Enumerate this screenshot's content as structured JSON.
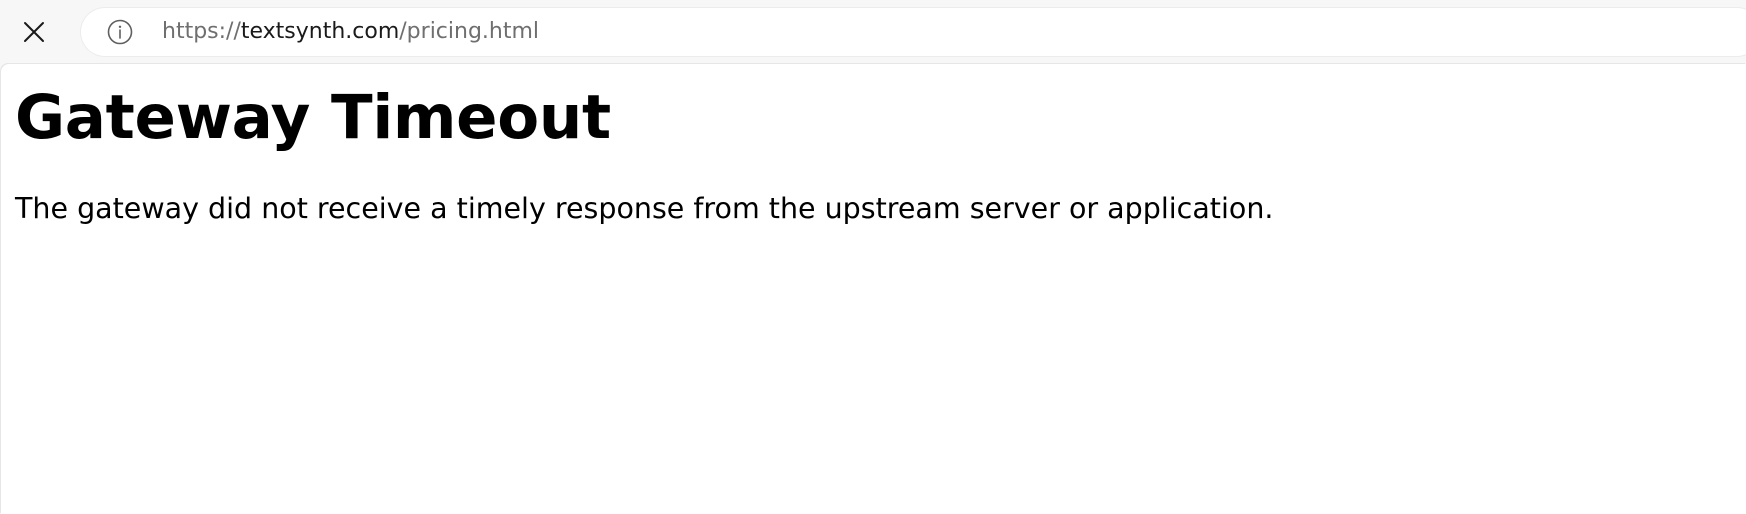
{
  "browser": {
    "close_icon": "close-icon",
    "info_icon": "info-icon",
    "url_prefix": "https://",
    "url_domain": "textsynth.com",
    "url_path": "/pricing.html"
  },
  "page": {
    "title": "Gateway Timeout",
    "message": "The gateway did not receive a timely response from the upstream server or application."
  }
}
